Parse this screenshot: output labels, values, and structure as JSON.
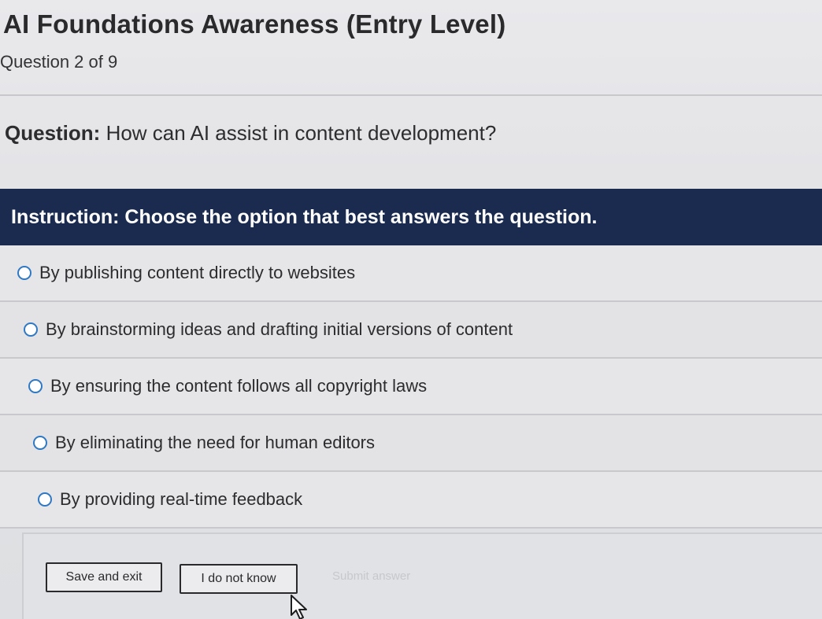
{
  "course": {
    "title": "AI Foundations Awareness (Entry Level)",
    "progress": "Question 2 of 9"
  },
  "question": {
    "label": "Question:",
    "text": " How can AI assist in content development?"
  },
  "instruction": {
    "text": "Instruction: Choose the option that best answers the question."
  },
  "options": [
    {
      "label": "By publishing content directly to websites",
      "selected": false
    },
    {
      "label": "By brainstorming ideas and drafting initial versions of content",
      "selected": false
    },
    {
      "label": "By ensuring the content follows all copyright laws",
      "selected": false
    },
    {
      "label": "By eliminating the need for human editors",
      "selected": false
    },
    {
      "label": "By providing real-time feedback",
      "selected": false
    }
  ],
  "actions": {
    "save_exit_label": "Save and exit",
    "dont_know_label": "I do not know",
    "submit_label": "Submit answer",
    "submit_enabled": false
  },
  "colors": {
    "instruction_bar": "#1b2b4f",
    "radio_border": "#2f78c4",
    "submit_disabled_text": "#c7c8cc"
  },
  "icons": {
    "radio": "radio-unchecked-icon",
    "cursor": "mouse-pointer-icon"
  }
}
